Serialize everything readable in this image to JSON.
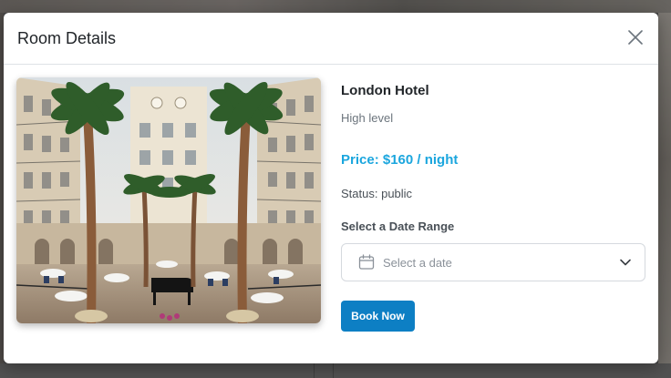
{
  "modal": {
    "title": "Room Details",
    "close_icon": "close-icon"
  },
  "room": {
    "name": "London Hotel",
    "level": "High level",
    "price": "Price: $160 / night",
    "status_label": "Status:",
    "status_value": "public"
  },
  "booking": {
    "range_label": "Select a Date Range",
    "date_placeholder": "Select a date",
    "calendar_icon": "calendar-icon",
    "chevron_icon": "chevron-down-icon",
    "book_label": "Book Now"
  },
  "colors": {
    "price": "#1ba6de",
    "book_button": "#0d7fc4"
  }
}
